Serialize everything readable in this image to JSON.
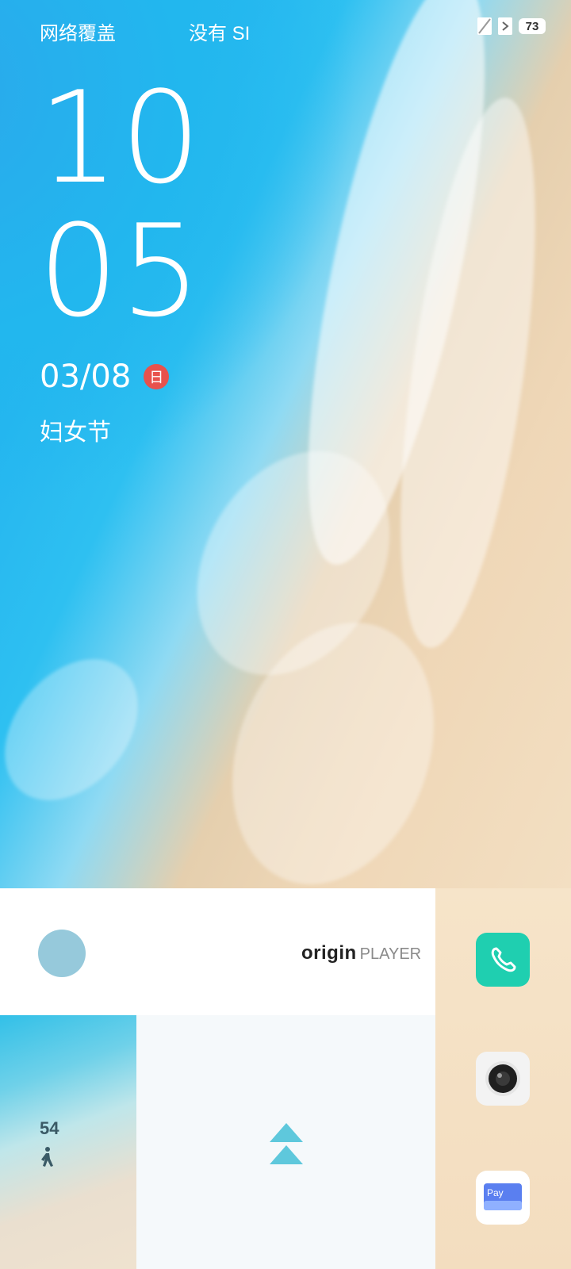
{
  "status_bar": {
    "carrier_1": "网络覆盖",
    "carrier_2": "没有 SI",
    "battery_level": "73",
    "icons": [
      "nfc-icon",
      "vibrate-icon",
      "battery-icon"
    ]
  },
  "lockscreen": {
    "hour": "10",
    "minute": "05",
    "date": "03/08",
    "weekday": "日",
    "holiday": "妇女节"
  },
  "widgets": {
    "player_logo_main": "origin",
    "player_logo_sub": "PLAYER",
    "steps": "54"
  },
  "dock": {
    "apps": [
      "phone-icon",
      "camera-icon",
      "pay-icon"
    ],
    "pay_label": "Pay"
  },
  "colors": {
    "phone_app": "#1fcfb0",
    "weekday_badge": "#e8524d",
    "slide_arrows": "#5ec8dc"
  }
}
